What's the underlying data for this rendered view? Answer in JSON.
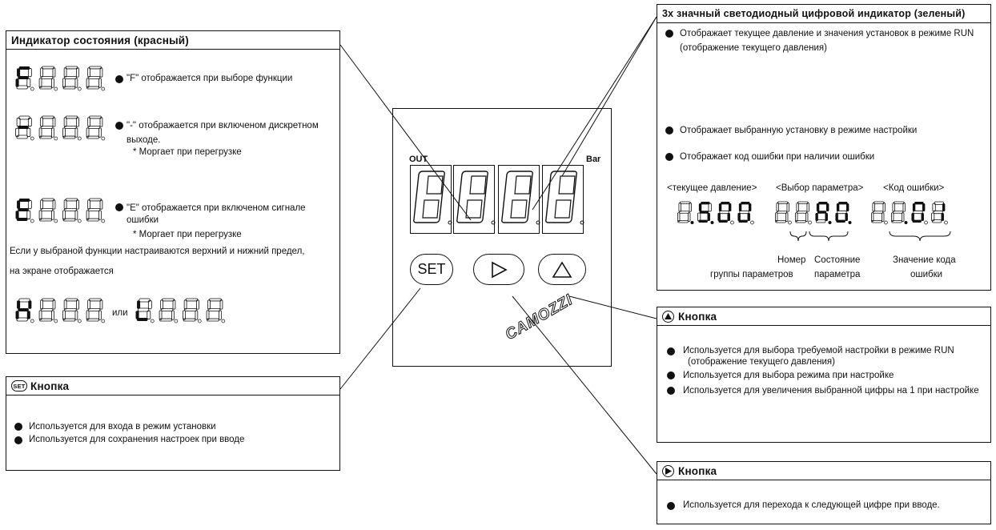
{
  "status_box": {
    "title": "Индикатор состояния (красный)",
    "f_note": "\"F\" отображается при выборе функции",
    "dash_note_1": "\"-\" отображается при включеном дискретном",
    "dash_note_2": "выходе.",
    "dash_note_3": "* Моргает при перегрузке",
    "e_note_1": "\"E\" отображается при включеном сигнале",
    "e_note_2": "ошибки",
    "e_note_3": "* Моргает при перегрузке",
    "limit_note_1": "Если у выбраной функции настраиваются верхний и нижний предел,",
    "limit_note_2": "на экране отображается",
    "or_word": "или",
    "examples": {
      "f": "F",
      "dash": "-",
      "e": "E",
      "h": "H",
      "l": "L"
    }
  },
  "set_box": {
    "icon_text": "SET",
    "title": "Кнопка",
    "items": [
      "Используется для входа в режим установки",
      "Используется для сохранения настроек при вводе"
    ]
  },
  "display_box": {
    "title": "3х значный светодиодный цифровой индикатор (зеленый)",
    "item1_line1": "Отображает текущее давление и значения установок в режиме RUN",
    "item1_line2": "(отображение текущего давления)",
    "item2": "Отображает выбранную установку в режиме настройки",
    "item3": "Отображает код ошибки при наличии ошибки",
    "example_labels": [
      "<текущее давление>",
      "<Выбор параметра>",
      "<Код ошибки>"
    ],
    "example_values": [
      "5.00",
      "1.A0.",
      "01"
    ],
    "example_prefix": [
      "",
      "F",
      "E"
    ],
    "brace_labels": {
      "group_1": "Номер",
      "group_2": "группы параметров",
      "state_1": "Состояние",
      "state_2": "параметра",
      "code_1": "Значение кода",
      "code_2": "ошибки"
    }
  },
  "up_box": {
    "title": "Кнопка",
    "item1_line1": "Используется для выбора требуемой настройки в режиме RUN",
    "item1_line2": "(отображение текущего давления)",
    "item2": "Используется для выбора режима при настройке",
    "item3": "Используется для увеличения выбранной цифры на 1 при настройке"
  },
  "right_box": {
    "title": "Кнопка",
    "item1": "Используется для перехода к следующей цифре при вводе."
  },
  "device": {
    "out_label": "OUT",
    "unit_label": "Bar",
    "set_label": "SET",
    "brand": "CAMOZZI",
    "digits": "8888"
  }
}
